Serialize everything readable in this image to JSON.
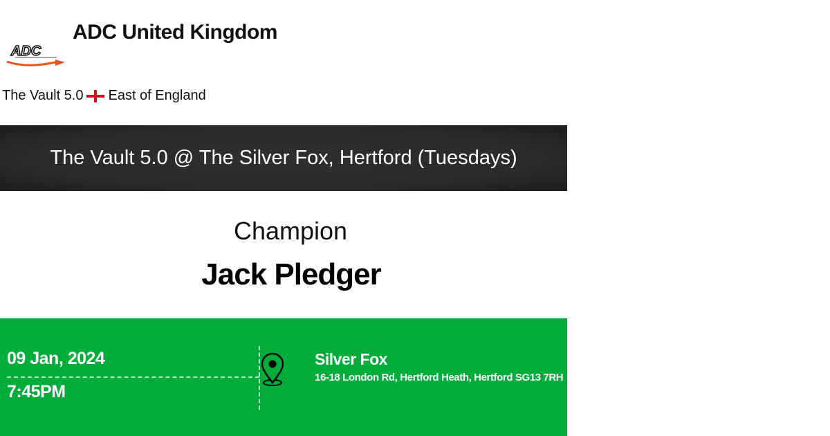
{
  "organization": {
    "name": "ADC United Kingdom",
    "logo_icon": "adc-logo"
  },
  "breadcrumb": {
    "league": "The Vault 5.0",
    "flag_icon": "england-flag-icon",
    "region": "East of England"
  },
  "event": {
    "title": "The Vault 5.0 @ The Silver Fox, Hertford (Tuesdays)"
  },
  "result": {
    "label": "Champion",
    "name": "Jack Pledger"
  },
  "details": {
    "date": "09 Jan, 2024",
    "time": "7:45PM",
    "location_icon": "map-pin-icon",
    "venue_name": "Silver Fox",
    "venue_address": "16-18 London Rd, Hertford Heath, Hertford SG13 7RH"
  },
  "colors": {
    "banner_background": "#2a2a2a",
    "details_background": "#00ad3a",
    "logo_orange": "#e8551c"
  }
}
